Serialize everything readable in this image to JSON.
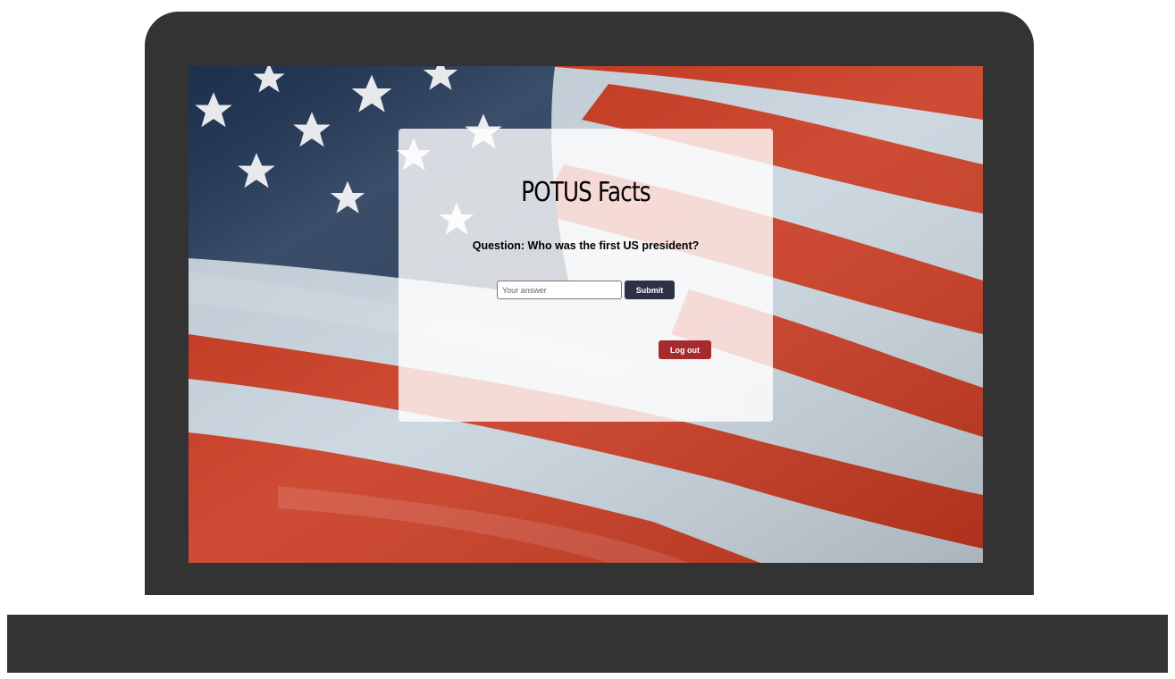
{
  "app": {
    "title": "POTUS Facts"
  },
  "quiz": {
    "question": "Question: Who was the first US president?",
    "answer_value": "",
    "answer_placeholder": "Your answer",
    "submit_label": "Submit"
  },
  "session": {
    "logout_label": "Log out"
  },
  "background": {
    "description_icon": "american-flag-background"
  },
  "colors": {
    "device_frame": "#333333",
    "submit_button": "#2d3047",
    "logout_button": "#a72a2f",
    "card_background": "rgba(255,255,255,0.8)"
  }
}
